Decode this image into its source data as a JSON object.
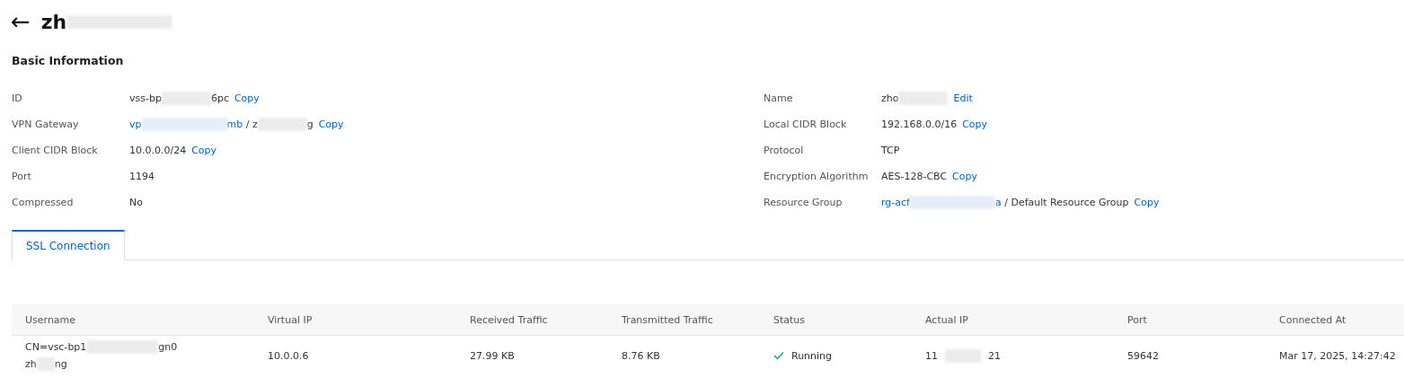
{
  "header": {
    "back": "←",
    "title": [
      {
        "kind": "text",
        "text": "zh"
      },
      {
        "kind": "redacted"
      }
    ]
  },
  "section_title": "Basic Information",
  "fields_left": [
    {
      "label": "ID",
      "value": [
        {
          "kind": "text",
          "text": "vss-bp"
        },
        {
          "kind": "redacted"
        },
        {
          "kind": "text",
          "text": "6pc"
        }
      ],
      "action": "Copy"
    },
    {
      "label": "VPN Gateway",
      "value": [
        {
          "kind": "link",
          "text": "vp"
        },
        {
          "kind": "redacted_link"
        },
        {
          "kind": "link",
          "text": "mb"
        },
        {
          "kind": "text",
          "text": " / "
        },
        {
          "kind": "text",
          "text": "z"
        },
        {
          "kind": "redacted"
        },
        {
          "kind": "text",
          "text": "g"
        }
      ],
      "action": "Copy"
    },
    {
      "label": "Client CIDR Block",
      "value": [
        {
          "kind": "text",
          "text": "10.0.0.0/24"
        }
      ],
      "action": "Copy"
    },
    {
      "label": "Port",
      "value": [
        {
          "kind": "text",
          "text": "1194"
        }
      ]
    },
    {
      "label": "Compressed",
      "value": [
        {
          "kind": "text",
          "text": "No"
        }
      ]
    }
  ],
  "fields_right": [
    {
      "label": "Name",
      "value": [
        {
          "kind": "text",
          "text": "zho"
        },
        {
          "kind": "redacted"
        }
      ],
      "action": "Edit"
    },
    {
      "label": "Local CIDR Block",
      "value": [
        {
          "kind": "text",
          "text": "192.168.0.0/16"
        }
      ],
      "action": "Copy"
    },
    {
      "label": "Protocol",
      "value": [
        {
          "kind": "text",
          "text": "TCP"
        }
      ]
    },
    {
      "label": "Encryption Algorithm",
      "value": [
        {
          "kind": "text",
          "text": "AES-128-CBC"
        }
      ],
      "action": "Copy"
    },
    {
      "label": "Resource Group",
      "value": [
        {
          "kind": "link",
          "text": "rg-acf"
        },
        {
          "kind": "redacted_link"
        },
        {
          "kind": "link",
          "text": "a"
        },
        {
          "kind": "text",
          "text": " / "
        },
        {
          "kind": "text",
          "text": "Default Resource Group"
        }
      ],
      "action": "Copy"
    }
  ],
  "tabs": [
    {
      "label": "SSL Connection",
      "selected": true
    }
  ],
  "table": {
    "columns": [
      "Username",
      "Virtual IP",
      "Received Traffic",
      "Transmitted Traffic",
      "Status",
      "Actual IP",
      "Port",
      "Connected At"
    ],
    "rows": [
      {
        "username": [
          [
            {
              "kind": "text",
              "text": "CN=vsc-bp1"
            },
            {
              "kind": "redacted"
            },
            {
              "kind": "text",
              "text": "gn0"
            }
          ],
          [
            {
              "kind": "text",
              "text": "zh"
            },
            {
              "kind": "redacted"
            },
            {
              "kind": "text",
              "text": "ng"
            }
          ]
        ],
        "virtual_ip": "10.0.0.6",
        "received": "27.99 KB",
        "transmitted": "8.76 KB",
        "status": {
          "kind": "running",
          "text": "Running"
        },
        "actual_ip": [
          {
            "kind": "text",
            "text": "11"
          },
          {
            "kind": "redacted"
          },
          {
            "kind": "text",
            "text": "21"
          }
        ],
        "port": "59642",
        "connected_at": "Mar 17, 2025, 14:27:42"
      }
    ]
  }
}
